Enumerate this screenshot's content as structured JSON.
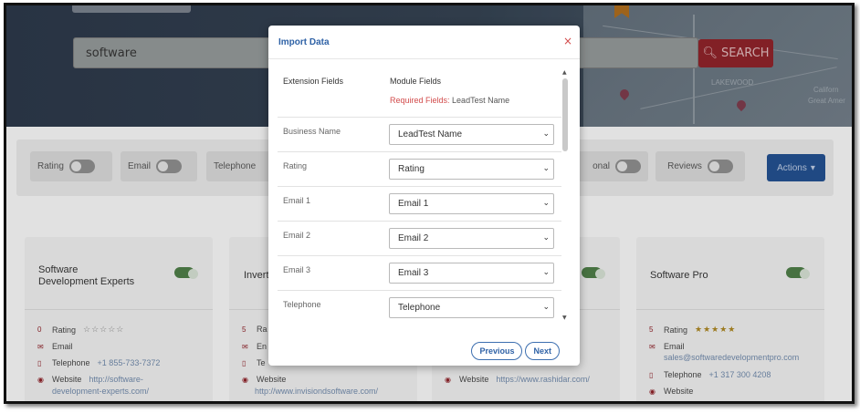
{
  "search": {
    "value": "software",
    "button_label": "SEARCH"
  },
  "map": {
    "labels": [
      "LAKEWOOD",
      "Californ",
      "Great Amer"
    ]
  },
  "filters": [
    {
      "label": "Rating",
      "on": false
    },
    {
      "label": "Email",
      "on": false
    },
    {
      "label": "Telephone",
      "on": false
    },
    {
      "label": "onal",
      "on": false
    },
    {
      "label": "Reviews",
      "on": false
    }
  ],
  "actions_label": "Actions",
  "cards": [
    {
      "title_line1": "Software",
      "title_line2": "Development Experts",
      "rating_count": "0",
      "rating_label": "Rating",
      "email_label": "Email",
      "telephone_label": "Telephone",
      "telephone_value": "+1 855-733-7372",
      "website_label": "Website",
      "website_value": "http://software-",
      "website_value2": "development-experts.com/"
    },
    {
      "title_line1": "Invert",
      "rating_count": "5",
      "rating_label": "Ra",
      "email_label": "En",
      "telephone_label": "Te",
      "website_label": "Website",
      "website_value": "http://www.invisiondsoftware.com/"
    },
    {
      "website_label": "Website",
      "website_value": "https://www.rashidar.com/"
    },
    {
      "title_line1": "Software Pro",
      "rating_count": "5",
      "rating_label": "Rating",
      "email_label": "Email",
      "email_value": "sales@softwaredevelopmentpro.com",
      "telephone_label": "Telephone",
      "telephone_value": "+1 317 300 4208",
      "website_label": "Website"
    }
  ],
  "modal": {
    "title": "Import Data",
    "close": "×",
    "col_extension": "Extension Fields",
    "col_module": "Module Fields",
    "required_prefix": "Required Fields:",
    "required_value": "LeadTest Name",
    "rows": [
      {
        "ext": "Business Name",
        "module": "LeadTest Name"
      },
      {
        "ext": "Rating",
        "module": "Rating"
      },
      {
        "ext": "Email 1",
        "module": "Email 1"
      },
      {
        "ext": "Email 2",
        "module": "Email 2"
      },
      {
        "ext": "Email 3",
        "module": "Email 3"
      },
      {
        "ext": "Telephone",
        "module": "Telephone"
      }
    ],
    "previous_label": "Previous",
    "next_label": "Next"
  },
  "colors": {
    "accent_blue": "#2f62a6",
    "search_red": "#8b2229",
    "close_red": "#d24b4b"
  }
}
